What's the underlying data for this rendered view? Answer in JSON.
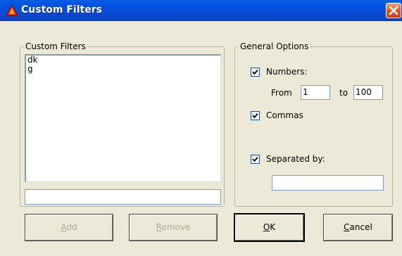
{
  "window": {
    "title": "Custom Filters"
  },
  "custom_filters": {
    "legend": "Custom Filters",
    "items": [
      "dk",
      "g"
    ],
    "input_value": "",
    "add_prefix": "",
    "add_key": "A",
    "add_rest": "dd",
    "remove_prefix": "",
    "remove_key": "R",
    "remove_rest": "emove"
  },
  "general_options": {
    "legend": "General Options",
    "numbers": {
      "label": "Numbers:",
      "checked": true
    },
    "from_label": "From",
    "from_value": "1",
    "to_label": "to",
    "to_value": "100",
    "commas": {
      "label": "Commas",
      "checked": true
    },
    "separated": {
      "label": "Separated by:",
      "checked": true
    },
    "separator_value": ""
  },
  "actions": {
    "ok_prefix": "",
    "ok_key": "O",
    "ok_rest": "K",
    "cancel_prefix": "",
    "cancel_key": "C",
    "cancel_rest": "ancel"
  }
}
